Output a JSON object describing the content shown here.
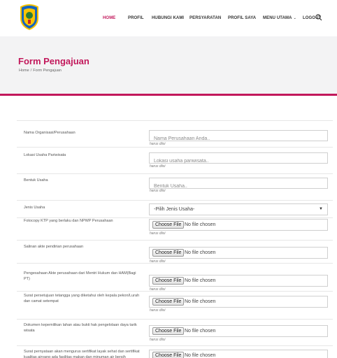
{
  "nav": {
    "items": [
      {
        "label": "HOME",
        "active": true
      },
      {
        "label": "PROFIL",
        "active": false
      },
      {
        "label": "HUBUNGI KAMI",
        "active": false
      },
      {
        "label": "PERSYARATAN",
        "active": false
      },
      {
        "label": "PROFIL SAYA",
        "active": false
      },
      {
        "label": "MENU UTAMA",
        "active": false,
        "dropdown": true
      },
      {
        "label": "LOGOUT",
        "active": false
      }
    ],
    "search_icon": "search-icon",
    "logo_icon": "regional-crest-icon"
  },
  "hero": {
    "title": "Form Pengajuan",
    "breadcrumb": [
      "Home",
      "Form Pengajuan"
    ],
    "breadcrumb_separator": "/"
  },
  "colors": {
    "accent": "#c2185b",
    "hero_bg": "#f3f3f4",
    "border": "#cfcfcf"
  },
  "form": {
    "help_text": "harus diisi",
    "fields": [
      {
        "label": "Nama Organisasi/Perusahaan",
        "type": "text",
        "placeholder": "Nama Perusahaan Anda.."
      },
      {
        "label": "Lokasi Usaha Pariwisata",
        "type": "text",
        "placeholder": "Lokasi usaha pariwisata.."
      },
      {
        "label": "Bentuk Usaha",
        "type": "text",
        "placeholder": "Bentuk Usaha.."
      },
      {
        "label": "Jenis Usaha",
        "type": "select",
        "selected": "-Pilih Jenis Usaha-"
      }
    ],
    "file_button": "Choose File",
    "file_status": "No file chosen",
    "file_fields": [
      {
        "label": "Fotocopy KTP yang berlaku dan NPWP Perusahaan"
      },
      {
        "label": "Salinan akte pendirian perusahaan"
      },
      {
        "label": "Pengesahaan Akte perusahaan dari Mentri Hukum dan HAM(Bagi PT)"
      },
      {
        "label": "Surat persetujuan tetangga yang diketahui oleh kepala pekon/Lurah dan camat setempat"
      },
      {
        "label": "Dokumen kepemilikan lahan atau bukti hak pengelolaan daya tarik wisata"
      },
      {
        "label": "Surat pernyataan akan mengurus sertifikat layak sehat dan sertifikat kualitas airyang ada fasilitas makan dan minuman air bersih"
      }
    ]
  }
}
